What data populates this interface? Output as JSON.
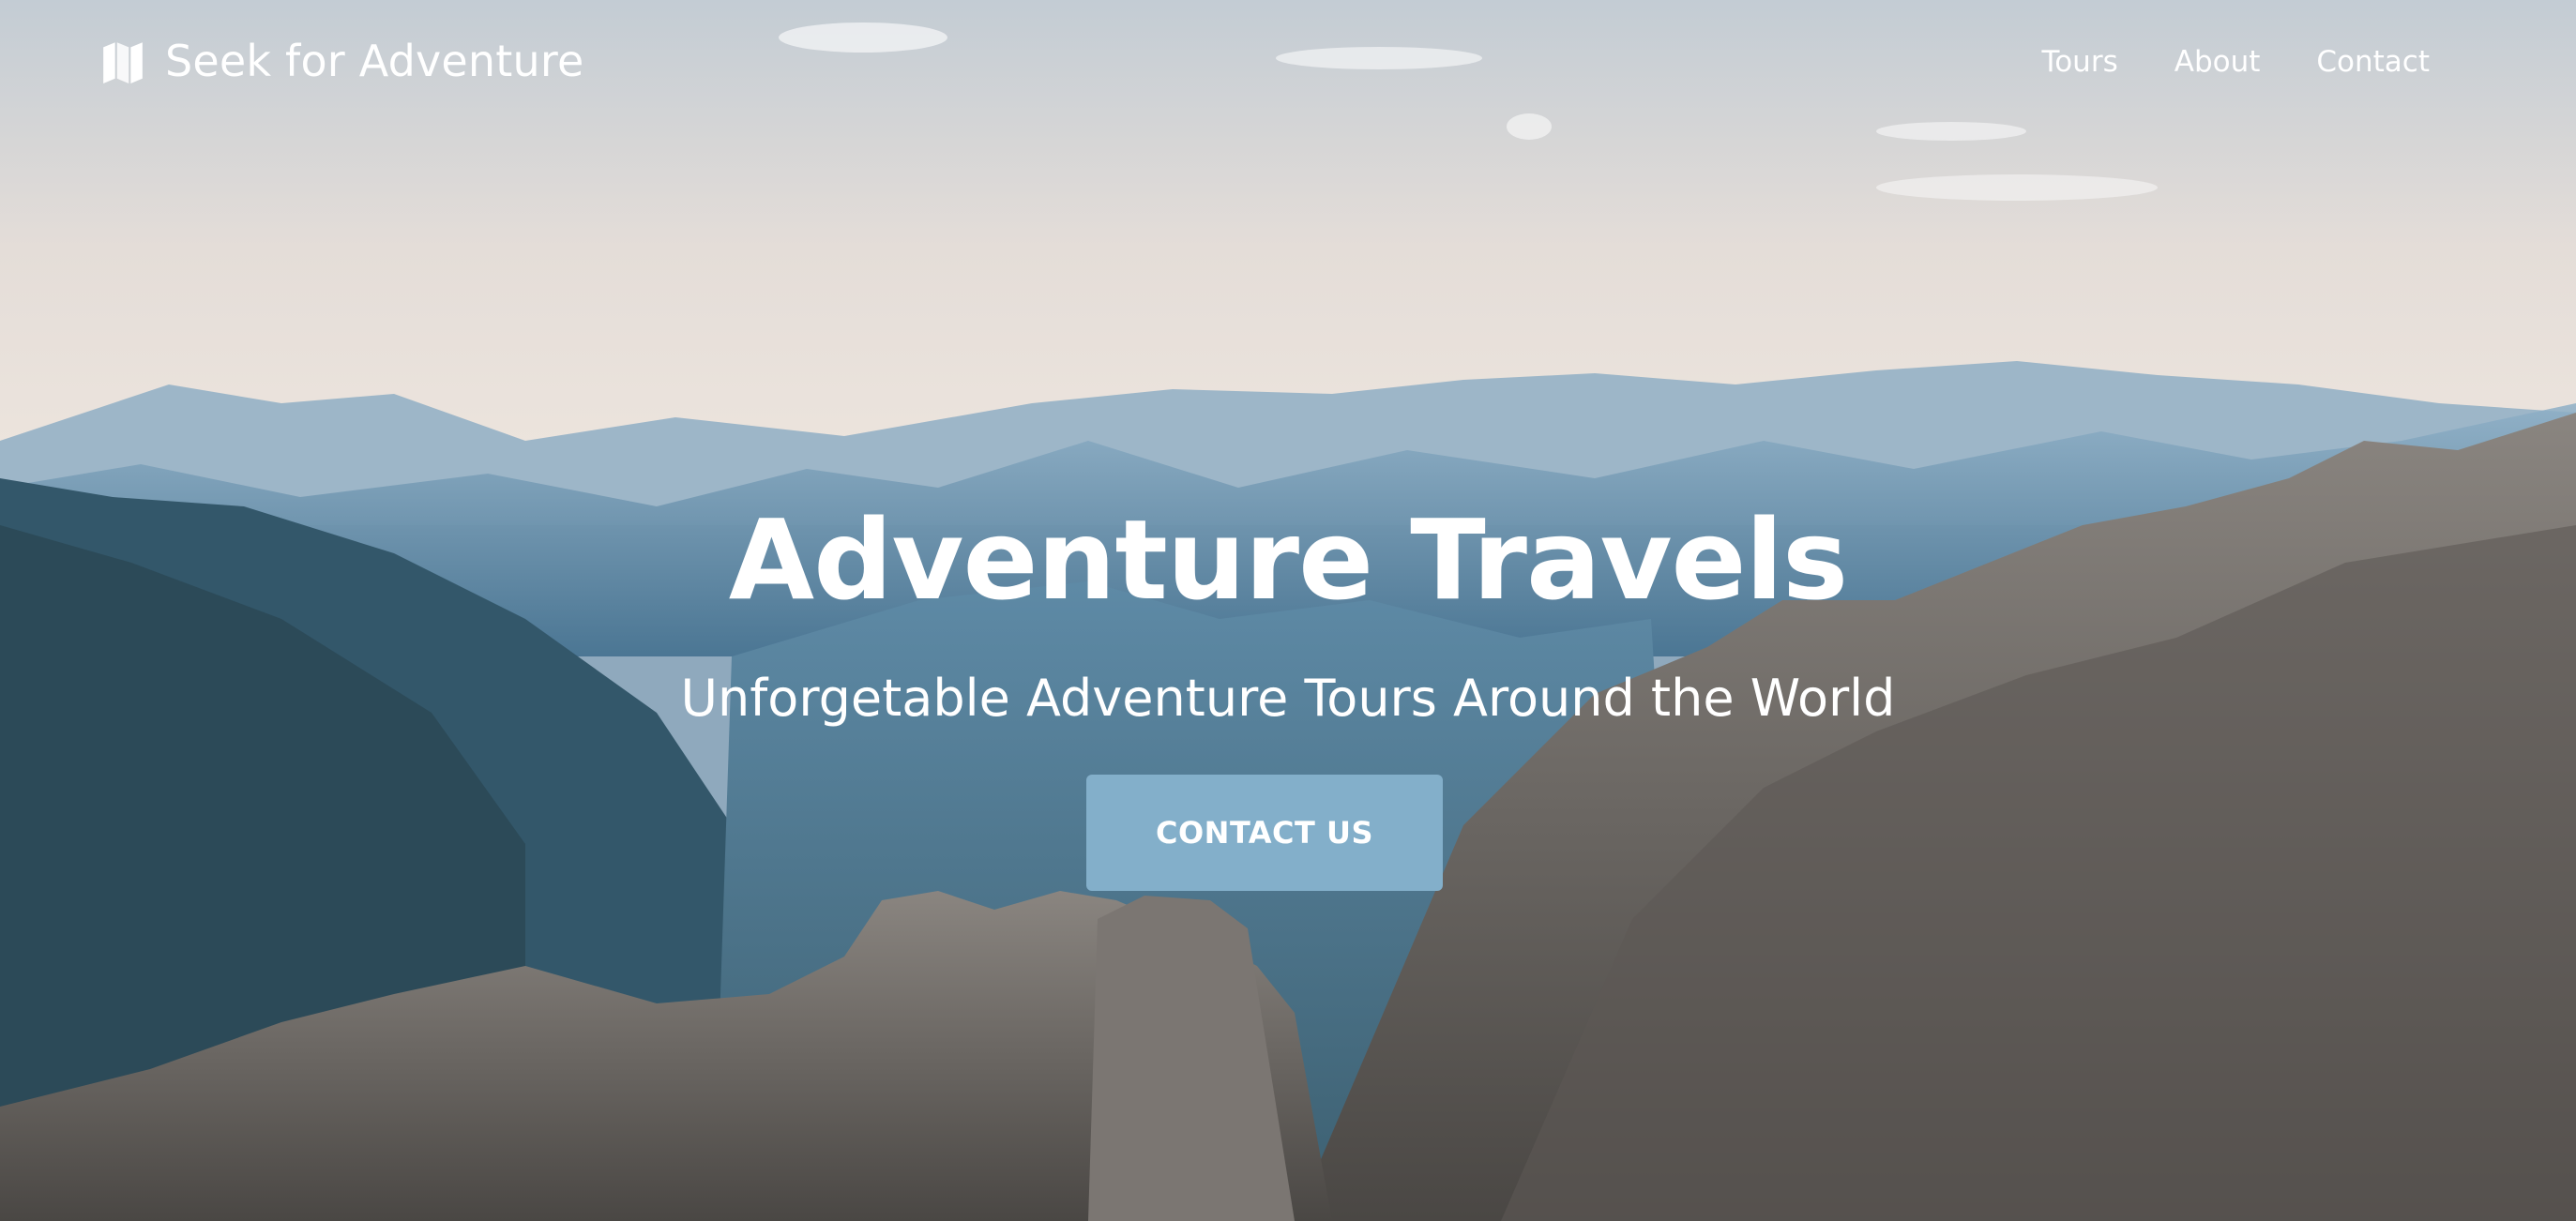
{
  "brand": {
    "name": "Seek for Adventure",
    "icon": "map-icon"
  },
  "nav": {
    "items": [
      {
        "label": "Tours"
      },
      {
        "label": "About"
      },
      {
        "label": "Contact"
      }
    ]
  },
  "hero": {
    "title": "Adventure Travels",
    "subtitle": "Unforgetable Adventure Tours Around the World",
    "cta_label": "CONTACT US",
    "background": "mountain-landscape-photo"
  },
  "colors": {
    "cta": "#83afca",
    "text": "#ffffff",
    "sky_top": "#c6cfd6",
    "sky_horizon": "#e7e0da",
    "mountain_blue": "#5c88a7",
    "rock": "#6e6a66"
  }
}
